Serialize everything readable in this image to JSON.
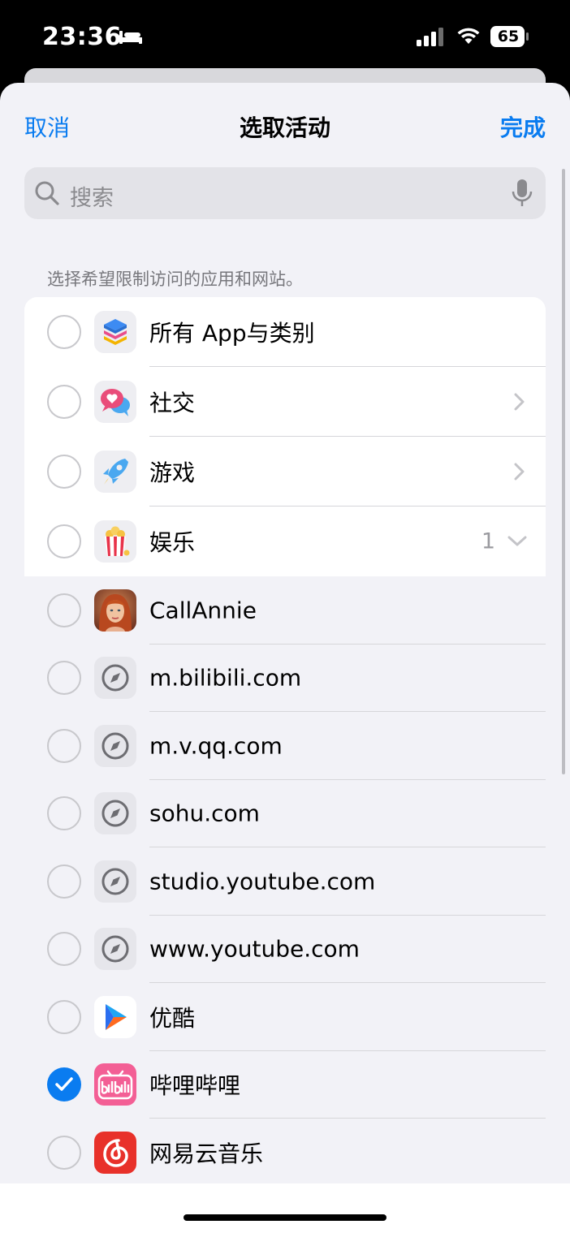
{
  "status_bar": {
    "time": "23:36",
    "battery": "65"
  },
  "nav": {
    "cancel_label": "取消",
    "title": "选取活动",
    "done_label": "完成"
  },
  "search": {
    "placeholder": "搜索"
  },
  "hint": "选择希望限制访问的应用和网站。",
  "categories": [
    {
      "label": "所有 App与类别",
      "icon": "stack-layers-icon"
    },
    {
      "label": "社交",
      "icon": "chat-heart-icon"
    },
    {
      "label": "游戏",
      "icon": "rocket-icon"
    },
    {
      "label": "娱乐",
      "icon": "popcorn-icon",
      "count": "1"
    }
  ],
  "items": [
    {
      "label": "CallAnnie",
      "icon": "callannie-avatar-icon",
      "checked": false
    },
    {
      "label": "m.bilibili.com",
      "icon": "compass-icon",
      "checked": false
    },
    {
      "label": "m.v.qq.com",
      "icon": "compass-icon",
      "checked": false
    },
    {
      "label": "sohu.com",
      "icon": "compass-icon",
      "checked": false
    },
    {
      "label": "studio.youtube.com",
      "icon": "compass-icon",
      "checked": false
    },
    {
      "label": "www.youtube.com",
      "icon": "compass-icon",
      "checked": false
    },
    {
      "label": "优酷",
      "icon": "youku-icon",
      "checked": false
    },
    {
      "label": "哔哩哔哩",
      "icon": "bilibili-icon",
      "checked": true
    },
    {
      "label": "网易云音乐",
      "icon": "netease-music-icon",
      "checked": false
    }
  ],
  "colors": {
    "accent": "#0a7cf0",
    "sheet_bg": "#f2f2f7"
  }
}
